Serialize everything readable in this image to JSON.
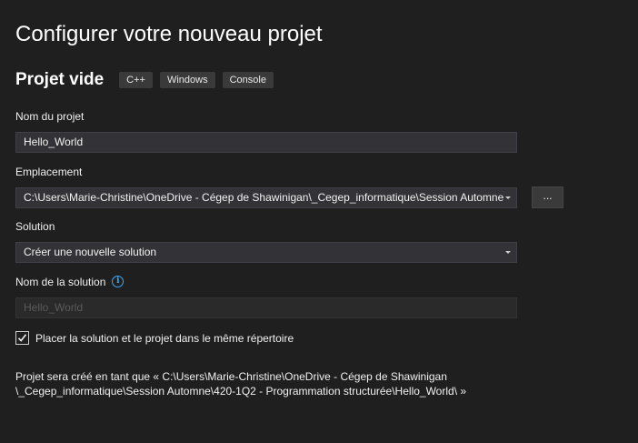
{
  "header": {
    "title": "Configurer votre nouveau projet",
    "template_name": "Projet vide",
    "tags": [
      "C++",
      "Windows",
      "Console"
    ]
  },
  "form": {
    "project_name": {
      "label": "Nom du projet",
      "value": "Hello_World"
    },
    "location": {
      "label": "Emplacement",
      "value": "C:\\Users\\Marie-Christine\\OneDrive - Cégep de Shawinigan\\_Cegep_informatique\\Session Automne",
      "browse_label": "..."
    },
    "solution": {
      "label": "Solution",
      "value": "Créer une nouvelle solution"
    },
    "solution_name": {
      "label": "Nom de la solution",
      "value": "Hello_World",
      "info_icon": "info-icon"
    },
    "same_directory": {
      "label": "Placer la solution et le projet dans le même répertoire",
      "checked": true
    }
  },
  "footer": {
    "line1": "Projet sera créé en tant que « C:\\Users\\Marie-Christine\\OneDrive - Cégep de Shawinigan",
    "line2": "\\_Cegep_informatique\\Session Automne\\420-1Q2 - Programmation structurée\\Hello_World\\ »"
  },
  "colors": {
    "background": "#1f1f1f",
    "field_background": "#333337",
    "accent_info": "#3fa9f5"
  }
}
